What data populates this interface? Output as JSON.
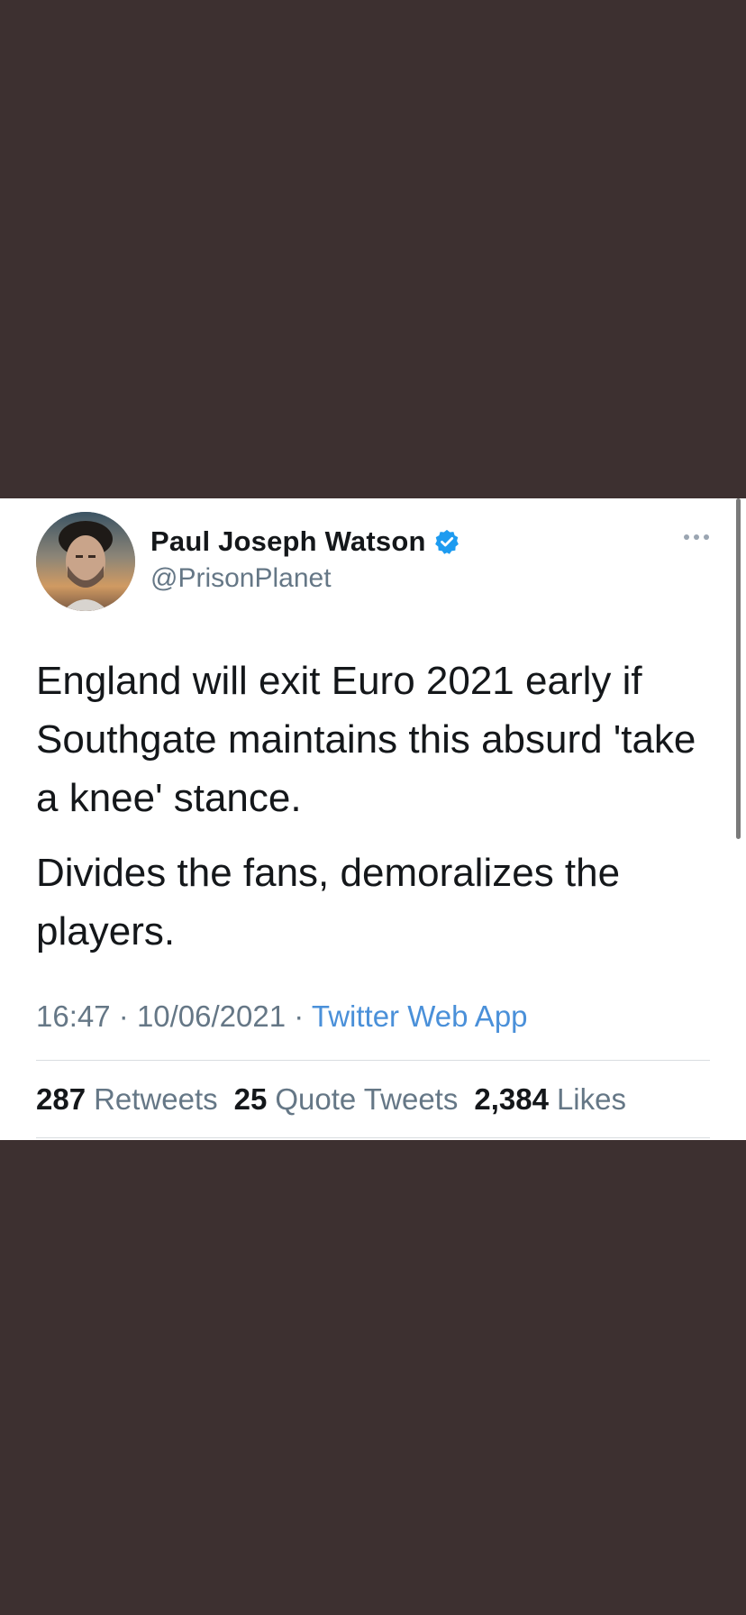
{
  "author": {
    "display_name": "Paul Joseph Watson",
    "handle": "@PrisonPlanet",
    "avatar_icon": "avatar-photo",
    "verified_icon": "verified-badge-icon"
  },
  "tweet": {
    "paragraphs": [
      "England will exit Euro 2021 early if Southgate maintains this absurd 'take a knee' stance.",
      "Divides the fans, demoralizes the players."
    ],
    "time": "16:47",
    "separator": "·",
    "date": "10/06/2021",
    "source": "Twitter Web App"
  },
  "stats": {
    "retweets_count": "287",
    "retweets_label": "Retweets",
    "quotes_count": "25",
    "quotes_label": "Quote Tweets",
    "likes_count": "2,384",
    "likes_label": "Likes"
  },
  "colors": {
    "background": "#3d3030",
    "card": "#ffffff",
    "text": "#14171a",
    "secondary": "#657786",
    "link": "#4a90d9",
    "verified": "#1d9bf0"
  }
}
